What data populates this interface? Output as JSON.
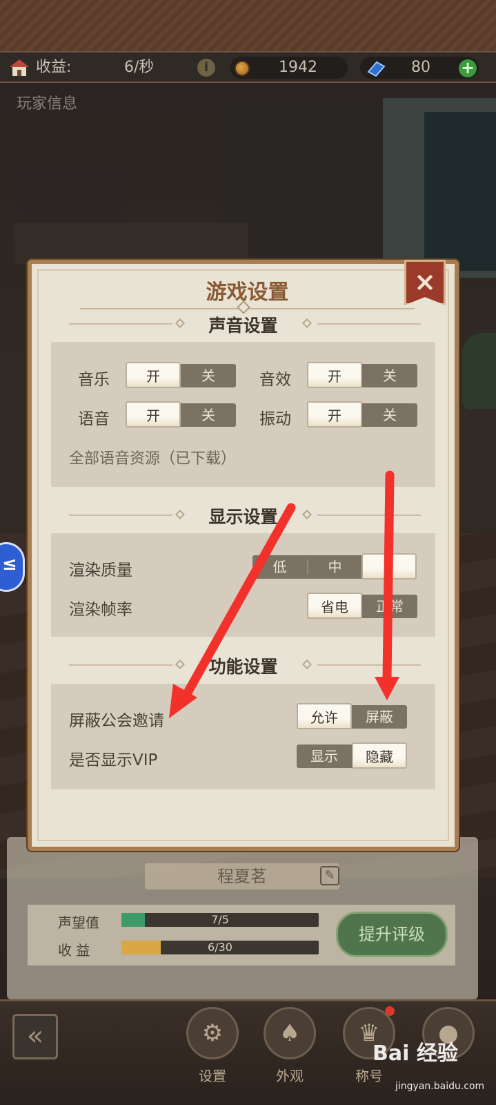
{
  "resources": {
    "income_label": "收益:",
    "income_value": "6/秒",
    "coins": "1942",
    "gems": "80",
    "info_icon": "info-icon",
    "add_icon": "plus-icon"
  },
  "scene": {
    "player_info_title": "玩家信息"
  },
  "modal": {
    "title": "游戏设置",
    "close_label": "×",
    "sound": {
      "heading": "声音设置",
      "music_label": "音乐",
      "sfx_label": "音效",
      "voice_label": "语音",
      "vibration_label": "振动",
      "on": "开",
      "off": "关",
      "music_state": "开",
      "sfx_state": "开",
      "voice_state": "开",
      "vibration_state": "开",
      "voice_resources": "全部语音资源（已下载）"
    },
    "display": {
      "heading": "显示设置",
      "quality_label": "渲染质量",
      "quality_options": [
        "低",
        "中",
        ""
      ],
      "quality_selected": 2,
      "framerate_label": "渲染帧率",
      "framerate_options": [
        "省电",
        "正常"
      ],
      "framerate_selected": 0
    },
    "function": {
      "heading": "功能设置",
      "guild_label": "屏蔽公会邀请",
      "guild_options": [
        "允许",
        "屏蔽"
      ],
      "guild_selected": 0,
      "vip_label": "是否显示VIP",
      "vip_options": [
        "显示",
        "隐藏"
      ],
      "vip_selected": 1
    }
  },
  "player_card": {
    "name": "程夏茗",
    "reputation_label": "声望值",
    "reputation_value": "7/5",
    "reputation_fraction": 0.12,
    "income_label": "收 益",
    "income_value": "6/30",
    "income_fraction": 0.2,
    "upgrade_button": "提升评级"
  },
  "bottom_nav": {
    "back_icon": "double-chevron-left-icon",
    "settings": "设置",
    "appearance": "外观",
    "title": "称号"
  },
  "watermark": {
    "brand": "Bai 经验",
    "url": "jingyan.baidu.com"
  },
  "colors": {
    "accent_wood": "#a87d4f",
    "title_brown": "#8a5a33",
    "close_red": "#9b3a2a",
    "arrow_red": "#f2312a",
    "upgrade_green": "#3d6b3f"
  }
}
